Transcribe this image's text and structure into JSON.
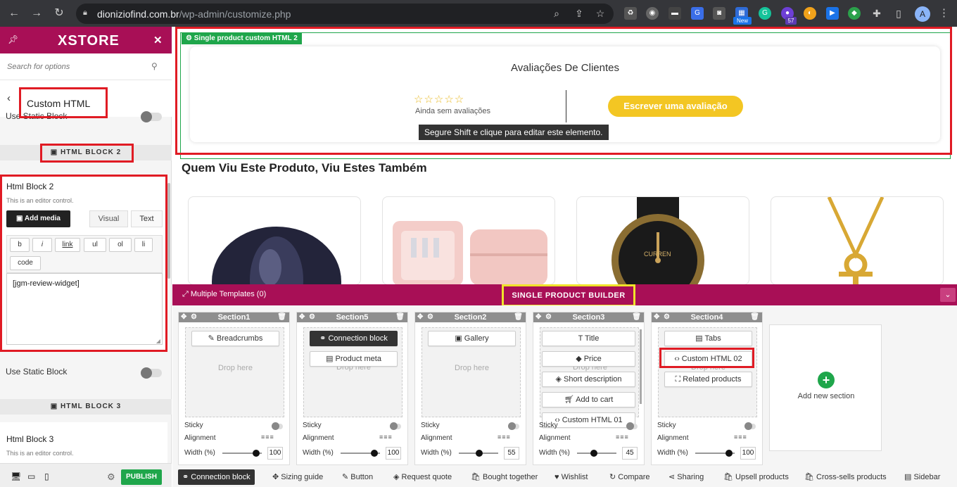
{
  "browser": {
    "url_host": "dioniziofind.com.br",
    "url_path": "/wp-admin/customize.php",
    "badge_new": "New",
    "badge_count": "57",
    "avatar_letter": "A"
  },
  "sidebar": {
    "logo": "XSTORE",
    "search_placeholder": "Search for options",
    "panel_title": "Custom HTML",
    "static_top": "Use Static Block",
    "block2_header": "HTML BLOCK 2",
    "block2_title": "Html Block 2",
    "block2_note": "This is an editor control.",
    "add_media": "Add media",
    "tab_visual": "Visual",
    "tab_text": "Text",
    "quicktags": [
      "b",
      "i",
      "link",
      "ul",
      "ol",
      "li",
      "code"
    ],
    "editor_content": "[jgm-review-widget]",
    "static_block": "Use Static Block",
    "block3_header": "HTML BLOCK 3",
    "block3_title": "Html Block 3",
    "block3_note": "This is an editor control.",
    "publish": "PUBLISH"
  },
  "preview": {
    "element_label": "Single product custom HTML 2",
    "review_title": "Avaliações De Clientes",
    "stars": "☆☆☆☆☆",
    "no_reviews": "Ainda sem avaliações",
    "review_button": "Escrever uma avaliação",
    "tooltip": "Segure Shift e clique para editar este elemento.",
    "related_heading": "Quem Viu Este Produto, Viu Estes Também",
    "watch_brand": "CURREN"
  },
  "builder": {
    "templates": "Multiple Templates (0)",
    "title": "SINGLE PRODUCT BUILDER",
    "drop_here": "Drop here",
    "sticky": "Sticky",
    "alignment": "Alignment",
    "width": "Width (%)",
    "add_section": "Add new section",
    "sections": [
      {
        "name": "Section1",
        "items": [
          "Breadcrumbs"
        ],
        "width": "100"
      },
      {
        "name": "Section5",
        "items": [
          "Connection block",
          "Product meta"
        ],
        "width": "100"
      },
      {
        "name": "Section2",
        "items": [
          "Gallery"
        ],
        "width": "55"
      },
      {
        "name": "Section3",
        "items": [
          "Title",
          "Price",
          "Short description",
          "Add to cart",
          "Custom HTML 01"
        ],
        "width": "45"
      },
      {
        "name": "Section4",
        "items": [
          "Tabs",
          "Custom HTML 02",
          "Related products"
        ],
        "width": "100"
      }
    ],
    "footer": [
      "Connection block",
      "Sizing guide",
      "Button",
      "Request quote",
      "Bought together",
      "Wishlist",
      "Compare",
      "Sharing",
      "Upsell products",
      "Cross-sells products",
      "Sidebar"
    ]
  }
}
